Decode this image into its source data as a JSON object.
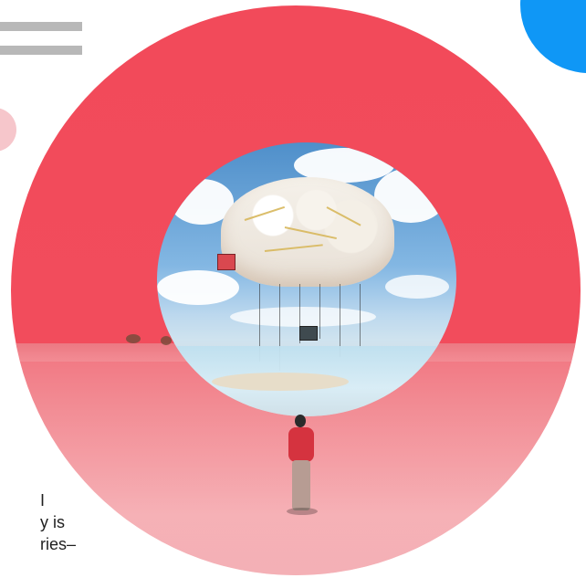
{
  "page": {
    "background": "#ffffff"
  },
  "decor": {
    "menu_color": "#b8b8b8",
    "blue_blob_color": "#0f97f6",
    "pink_dot_color": "#f6c6cb",
    "hero_ring_color": "#f24a5a"
  },
  "hero_image": {
    "icon": "surreal-brain-landscape-image"
  },
  "caption": {
    "lines": [
      "I",
      "y is",
      "ries–"
    ]
  }
}
